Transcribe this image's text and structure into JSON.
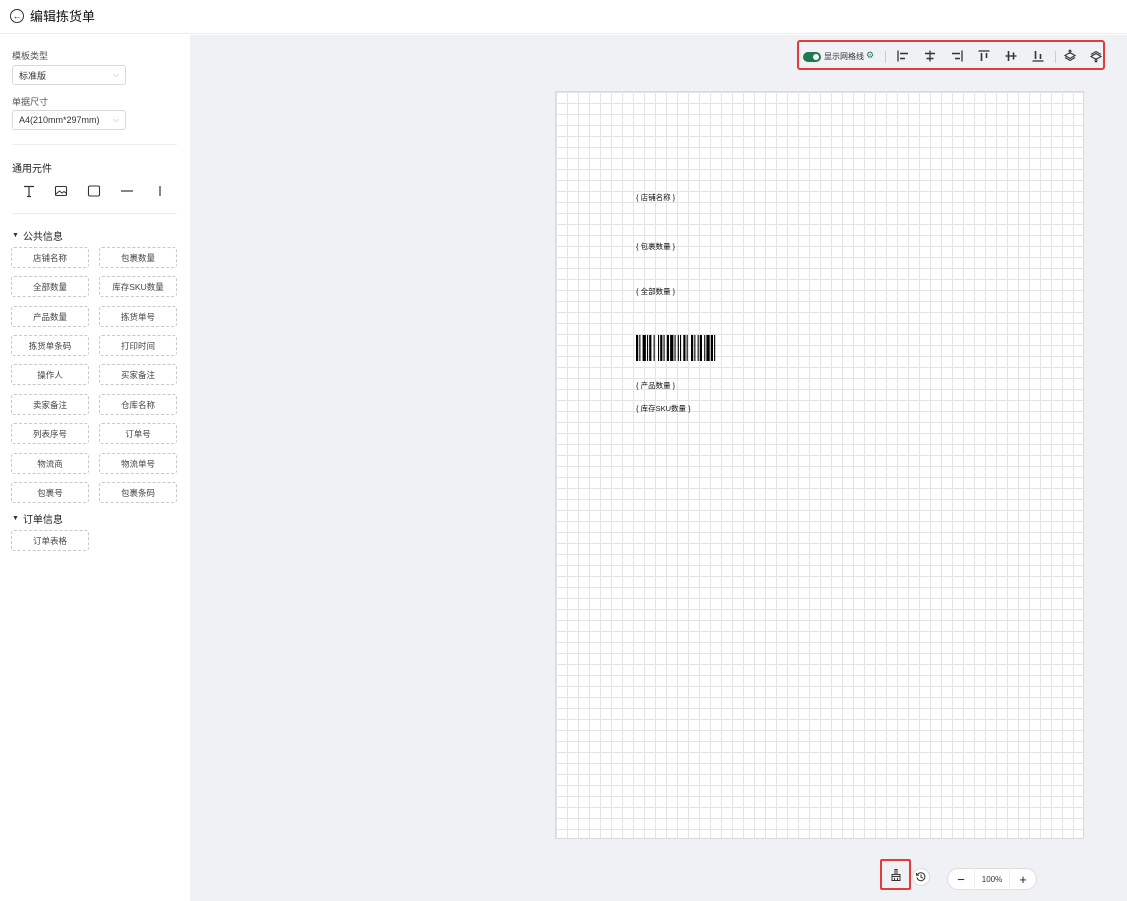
{
  "header": {
    "title": "编辑拣货单"
  },
  "sidebar": {
    "template_type_label": "模板类型",
    "template_type_value": "标准版",
    "paper_size_label": "单据尺寸",
    "paper_size_value": "A4(210mm*297mm)",
    "common_components_title": "通用元件",
    "tools": [
      "text-icon",
      "image-icon",
      "rectangle-icon",
      "horizontal-line-icon",
      "vertical-line-icon"
    ],
    "groups": [
      {
        "title": "公共信息",
        "chips": [
          "店铺名称",
          "包裹数量",
          "全部数量",
          "库存SKU数量",
          "产品数量",
          "拣货单号",
          "拣货单条码",
          "打印时间",
          "操作人",
          "买家备注",
          "卖家备注",
          "仓库名称",
          "列表序号",
          "订单号",
          "物流商",
          "物流单号",
          "包裹号",
          "包裹条码"
        ]
      },
      {
        "title": "订单信息",
        "chips": [
          "订单表格"
        ]
      }
    ]
  },
  "toolbar": {
    "grid_label": "显示网格线",
    "accent_color": "#1f7a4f",
    "highlight_color": "#e23b3b"
  },
  "canvas": {
    "fields": [
      "{ 店铺名称 }",
      "{ 包裹数量 }",
      "{ 全部数量 }",
      "{ 产品数量 }",
      "{ 库存SKU数量 }"
    ]
  },
  "footer": {
    "zoom": "100%",
    "zoom_out": "−",
    "zoom_in": "+"
  }
}
